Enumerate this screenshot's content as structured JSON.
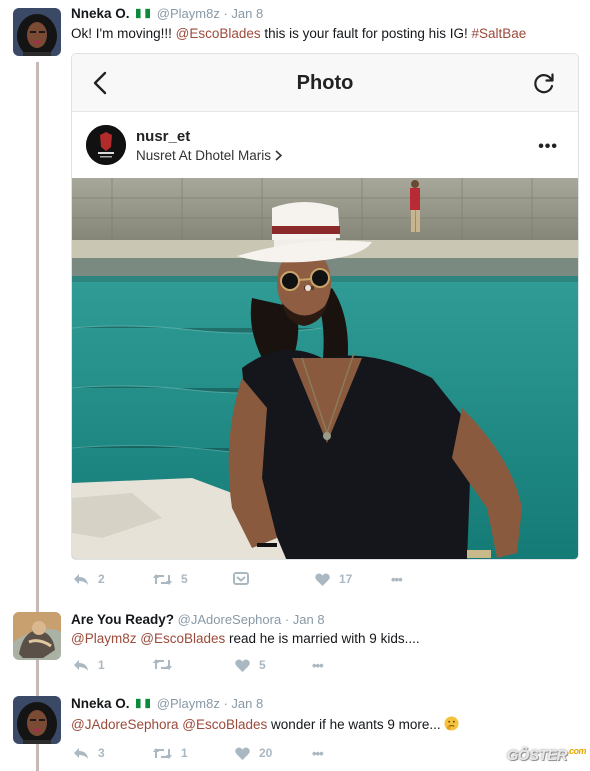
{
  "tweets": [
    {
      "name": "Nneka O.",
      "handle": "@Playm8z",
      "date": "Jan 8",
      "text_parts": [
        "Ok! I'm moving!!! ",
        "@EscoBlades",
        " this is your fault for posting his IG! ",
        "#SaltBae"
      ],
      "actions": {
        "reply": "2",
        "retweet": "5",
        "like": "17"
      }
    },
    {
      "name": "Are You Ready?",
      "handle": "@JAdoreSephora",
      "date": "Jan 8",
      "text_parts": [
        "@Playm8z",
        " ",
        "@EscoBlades",
        "  read he is married with 9 kids...."
      ],
      "actions": {
        "reply": "1",
        "retweet": "",
        "like": "5"
      }
    },
    {
      "name": "Nneka O.",
      "handle": "@Playm8z",
      "date": "Jan 8",
      "text_parts": [
        "@JAdoreSephora",
        " ",
        "@EscoBlades",
        " wonder if he wants 9 more... "
      ],
      "actions": {
        "reply": "3",
        "retweet": "1",
        "like": "20"
      }
    }
  ],
  "separator": "·",
  "card": {
    "nav_title": "Photo",
    "username": "nusr_et",
    "location": "Nusret At Dhotel Maris",
    "more": "•••"
  },
  "more_dots": "•••",
  "watermark": {
    "main": "GÖSTER",
    "suffix": ".com"
  },
  "colors": {
    "mention": "#9c4a3a",
    "icon_gray": "#aab8c2",
    "thread_line": "#c8b9b6"
  }
}
